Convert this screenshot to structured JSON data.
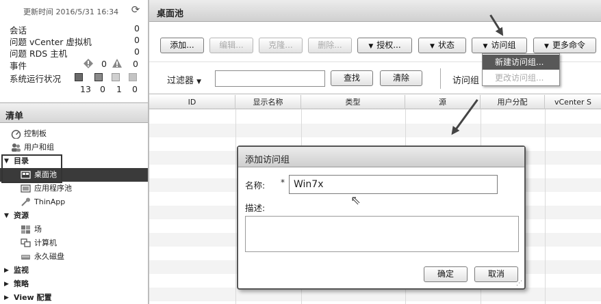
{
  "sidebar": {
    "status": {
      "updated_label": "更新时间 2016/5/31 16:34",
      "rows": [
        {
          "label": "会话",
          "value": "0"
        },
        {
          "label": "问题 vCenter 虚拟机",
          "value": "0"
        },
        {
          "label": "问题 RDS 主机",
          "value": "0"
        },
        {
          "label": "事件",
          "value": ""
        },
        {
          "label": "系统运行状况",
          "value": ""
        }
      ],
      "event_counts": [
        "0",
        "0"
      ],
      "health_counts": [
        "13",
        "0",
        "1",
        "0"
      ]
    },
    "list_title": "清单",
    "items": [
      {
        "label": "控制板",
        "icon": "dashboard-icon"
      },
      {
        "label": "用户和组",
        "icon": "users-icon"
      },
      {
        "label": "目录",
        "icon": "expanded-triangle"
      },
      {
        "label": "桌面池",
        "icon": "desktop-pool-icon"
      },
      {
        "label": "应用程序池",
        "icon": "app-pool-icon"
      },
      {
        "label": "ThinApp",
        "icon": "thinapp-icon"
      },
      {
        "label": "资源",
        "icon": "expanded-triangle"
      },
      {
        "label": "场",
        "icon": "farm-icon"
      },
      {
        "label": "计算机",
        "icon": "computer-icon"
      },
      {
        "label": "永久磁盘",
        "icon": "disk-icon"
      },
      {
        "label": "监视",
        "icon": "collapsed-triangle"
      },
      {
        "label": "策略",
        "icon": "collapsed-triangle"
      },
      {
        "label": "View 配置",
        "icon": "collapsed-triangle"
      }
    ]
  },
  "main": {
    "title": "桌面池",
    "toolbar": {
      "add": "添加...",
      "edit": "编辑...",
      "clone": "克隆...",
      "delete": "删除...",
      "entitle": "授权...",
      "status": "状态",
      "access_group": "访问组",
      "more": "更多命令"
    },
    "menu": {
      "new_access_group": "新建访问组...",
      "change_access_group": "更改访问组..."
    },
    "filter": {
      "label": "过滤器",
      "find": "查找",
      "clear": "清除",
      "access_group_label": "访问组"
    },
    "table": {
      "columns": [
        "ID",
        "显示名称",
        "类型",
        "源",
        "用户分配",
        "vCenter S"
      ]
    }
  },
  "dialog": {
    "title": "添加访问组",
    "name_label": "名称:",
    "required_mark": "*",
    "name_value": "Win7x",
    "desc_label": "描述:",
    "ok": "确定",
    "cancel": "取消"
  }
}
